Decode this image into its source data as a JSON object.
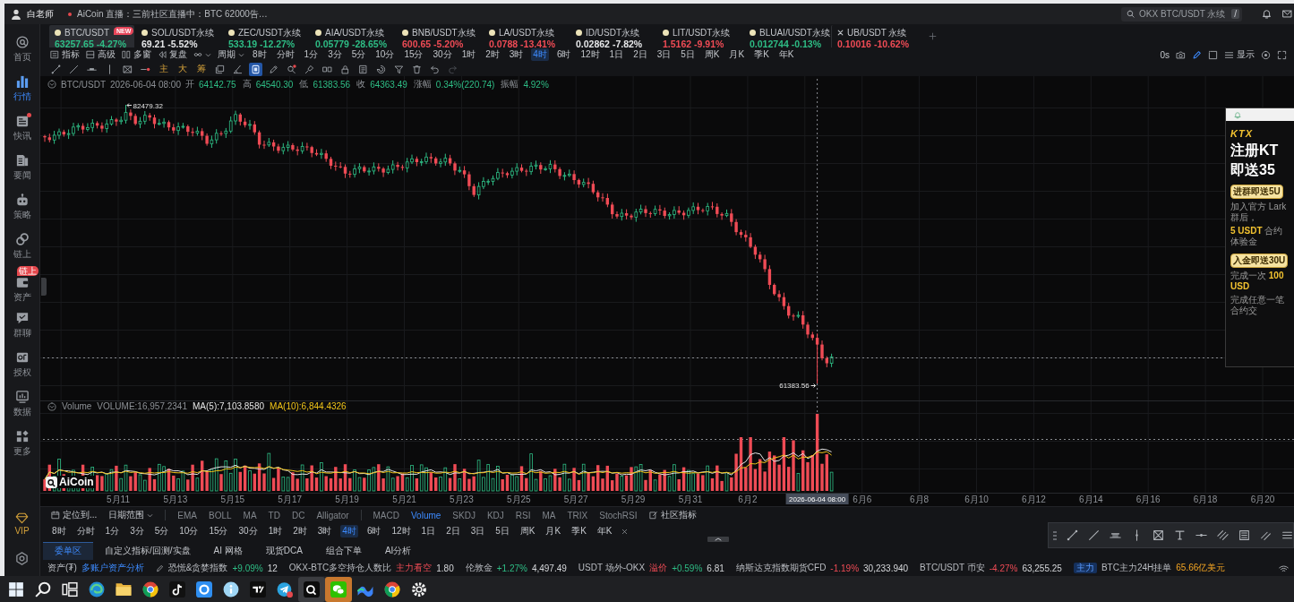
{
  "title_bar": {
    "user": "白老师",
    "live_label": "AiCoin 直播：三前社区直播中：BTC 62000告…",
    "search": {
      "value": "OKX BTC/USDT 永续",
      "shortcut": "/"
    }
  },
  "sidebar": {
    "items": [
      {
        "kind": "home",
        "label": "首页",
        "selected": false,
        "alert": false
      },
      {
        "kind": "market",
        "label": "行情",
        "selected": true,
        "alert": false
      },
      {
        "kind": "flash",
        "label": "快讯",
        "selected": false,
        "alert": true
      },
      {
        "kind": "news",
        "label": "要闻",
        "selected": false,
        "alert": false
      },
      {
        "kind": "strategy",
        "label": "策略",
        "selected": false,
        "alert": false
      },
      {
        "kind": "onchain",
        "label": "链上",
        "selected": false,
        "alert": false
      },
      {
        "kind": "assets",
        "label": "资产",
        "selected": false,
        "alert": false,
        "badge": "链上"
      },
      {
        "kind": "chat",
        "label": "群聊",
        "selected": false,
        "alert": false
      },
      {
        "kind": "auth",
        "label": "授权",
        "selected": false,
        "alert": false
      },
      {
        "kind": "data",
        "label": "数据",
        "selected": false,
        "alert": false
      },
      {
        "kind": "more",
        "label": "更多",
        "selected": false,
        "alert": false
      }
    ],
    "vip": "VIP"
  },
  "symbol_tabs": [
    {
      "symbol": "BTC/USDT",
      "price": "63257.65",
      "change": "-4.27%",
      "color": "#2ebd85",
      "selected": true,
      "closable": false,
      "badge": "NEW"
    },
    {
      "symbol": "SOL/USDT永续",
      "price": "69.21",
      "change": "-5.52%",
      "color": "#e6e7e9",
      "selected": false,
      "closable": false
    },
    {
      "symbol": "ZEC/USDT永续",
      "price": "533.19",
      "change": "-12.27%",
      "color": "#2ebd85",
      "selected": false,
      "closable": false
    },
    {
      "symbol": "AIA/USDT永续",
      "price": "0.05779",
      "change": "-28.65%",
      "color": "#2ebd85",
      "selected": false,
      "closable": false
    },
    {
      "symbol": "BNB/USDT永续",
      "price": "600.65",
      "change": "-5.20%",
      "color": "#ef4b55",
      "selected": false,
      "closable": false
    },
    {
      "symbol": "LA/USDT永续",
      "price": "0.0788",
      "change": "-13.41%",
      "color": "#ef4b55",
      "selected": false,
      "closable": false
    },
    {
      "symbol": "ID/USDT永续",
      "price": "0.02862",
      "change": "-7.82%",
      "color": "#e6e7e9",
      "selected": false,
      "closable": false
    },
    {
      "symbol": "LIT/USDT永续",
      "price": "1.5162",
      "change": "-9.91%",
      "color": "#ef4b55",
      "selected": false,
      "closable": false
    },
    {
      "symbol": "BLUAI/USDT永续",
      "price": "0.012744",
      "change": "-0.13%",
      "color": "#2ebd85",
      "selected": false,
      "closable": false
    },
    {
      "symbol": "UB/USDT 永续",
      "price": "0.10016",
      "change": "-10.62%",
      "color": "#ef4b55",
      "selected": false,
      "closable": true
    }
  ],
  "toolbar": {
    "buttons": [
      {
        "kind": "indicator",
        "label": "指标"
      },
      {
        "kind": "advanced",
        "label": "高级"
      },
      {
        "kind": "multi",
        "label": "多窗"
      },
      {
        "kind": "replay",
        "label": "复盘"
      }
    ],
    "period_menu": "周期",
    "periods": [
      {
        "label": "8时",
        "selected": false
      },
      {
        "label": "分时",
        "selected": false
      },
      {
        "label": "1分",
        "selected": false
      },
      {
        "label": "3分",
        "selected": false
      },
      {
        "label": "5分",
        "selected": false
      },
      {
        "label": "10分",
        "selected": false
      },
      {
        "label": "15分",
        "selected": false
      },
      {
        "label": "30分",
        "selected": false
      },
      {
        "label": "1时",
        "selected": false
      },
      {
        "label": "2时",
        "selected": false
      },
      {
        "label": "3时",
        "selected": false
      },
      {
        "label": "4时",
        "selected": true
      },
      {
        "label": "6时",
        "selected": false
      },
      {
        "label": "12时",
        "selected": false
      },
      {
        "label": "1日",
        "selected": false
      },
      {
        "label": "2日",
        "selected": false
      },
      {
        "label": "3日",
        "selected": false
      },
      {
        "label": "5日",
        "selected": false
      },
      {
        "label": "周K",
        "selected": false
      },
      {
        "label": "月K",
        "selected": false
      },
      {
        "label": "季K",
        "selected": false
      },
      {
        "label": "年K",
        "selected": false
      }
    ],
    "timer": "0s",
    "display": "显示"
  },
  "drawing_tools": [
    {
      "kind": "trend-line",
      "selected": false
    },
    {
      "kind": "ray",
      "selected": false
    },
    {
      "kind": "horizontal-line",
      "selected": false
    },
    {
      "kind": "vertical-line",
      "selected": false
    },
    {
      "kind": "box",
      "selected": false
    },
    {
      "kind": "marker",
      "selected": false
    },
    {
      "kind": "text",
      "label": "主",
      "selected": false
    },
    {
      "kind": "text",
      "label": "大",
      "selected": false
    },
    {
      "kind": "text",
      "label": "筹",
      "selected": false
    },
    {
      "kind": "copy",
      "selected": false
    },
    {
      "kind": "ruler",
      "selected": false
    },
    {
      "kind": "square",
      "selected": true
    },
    {
      "kind": "pencil",
      "selected": false
    },
    {
      "kind": "zoom",
      "selected": false
    },
    {
      "kind": "brush",
      "selected": false
    },
    {
      "kind": "link",
      "selected": false
    },
    {
      "kind": "lock",
      "selected": false
    },
    {
      "kind": "note",
      "selected": false
    },
    {
      "kind": "eye",
      "selected": false
    },
    {
      "kind": "filter",
      "selected": false
    },
    {
      "kind": "trash",
      "selected": false
    },
    {
      "kind": "undo",
      "selected": false
    },
    {
      "kind": "redo",
      "selected": false
    }
  ],
  "quote_info": {
    "symbol": "BTC/USDT",
    "time": "2026-06-04 08:00",
    "fields": [
      {
        "label": "开",
        "value": "64142.75"
      },
      {
        "label": "高",
        "value": "64540.30"
      },
      {
        "label": "低",
        "value": "61383.56"
      },
      {
        "label": "收",
        "value": "64363.49"
      },
      {
        "label": "涨幅",
        "value": "0.34%(220.74)"
      },
      {
        "label": "振幅",
        "value": "4.92%"
      }
    ]
  },
  "price_chart": {
    "high_label": "82479.32",
    "low_label": "61383.56",
    "x_axis": [
      {
        "kind": "tick",
        "label": "5月11"
      },
      {
        "kind": "tick",
        "label": "5月13"
      },
      {
        "kind": "tick",
        "label": "5月15"
      },
      {
        "kind": "tick",
        "label": "5月17"
      },
      {
        "kind": "tick",
        "label": "5月19"
      },
      {
        "kind": "tick",
        "label": "5月21"
      },
      {
        "kind": "tick",
        "label": "5月23"
      },
      {
        "kind": "tick",
        "label": "5月25"
      },
      {
        "kind": "tick",
        "label": "5月27"
      },
      {
        "kind": "tick",
        "label": "5月29"
      },
      {
        "kind": "tick",
        "label": "5月31"
      },
      {
        "kind": "tick",
        "label": "6月2"
      },
      {
        "kind": "crosshair",
        "label": "2026-06-04 08:00"
      },
      {
        "kind": "tick",
        "label": "6月6"
      },
      {
        "kind": "tick",
        "label": "6月8"
      },
      {
        "kind": "tick",
        "label": "6月10"
      },
      {
        "kind": "tick",
        "label": "6月12"
      },
      {
        "kind": "tick",
        "label": "6月14"
      },
      {
        "kind": "tick",
        "label": "6月16"
      },
      {
        "kind": "tick",
        "label": "6月18"
      },
      {
        "kind": "tick",
        "label": "6月20"
      }
    ],
    "logo": "AiCoin",
    "volume_legend": {
      "name": "Volume",
      "value": "VOLUME:16,957.2341",
      "ma5": "MA(5):7,103.8580",
      "ma10": "MA(10):6,844.4326"
    }
  },
  "ad": {
    "brand": "KTX",
    "headline": [
      "注册KT",
      "即送35"
    ],
    "offers": [
      {
        "button": "进群即送5U",
        "lines": [
          "加入官方 Lark 群后，",
          "**5 USDT** 合约体验金"
        ]
      },
      {
        "button": "入金即送30U",
        "lines": [
          "完成一次 **100 USD**",
          "完成任意一笔合约交"
        ]
      }
    ]
  },
  "indicator_bar": {
    "locate": "定位到...",
    "date_range": "日期范围",
    "main_indicators": [
      {
        "label": "EMA",
        "selected": false
      },
      {
        "label": "BOLL",
        "selected": false
      },
      {
        "label": "MA",
        "selected": false
      },
      {
        "label": "TD",
        "selected": false
      },
      {
        "label": "DC",
        "selected": false
      },
      {
        "label": "Alligator",
        "selected": false
      }
    ],
    "sub_indicators": [
      {
        "label": "MACD",
        "selected": false
      },
      {
        "label": "Volume",
        "selected": true
      },
      {
        "label": "SKDJ",
        "selected": false
      },
      {
        "label": "KDJ",
        "selected": false
      },
      {
        "label": "RSI",
        "selected": false
      },
      {
        "label": "MA",
        "selected": false
      },
      {
        "label": "TRIX",
        "selected": false
      },
      {
        "label": "StochRSI",
        "selected": false
      }
    ],
    "community": "社区指标"
  },
  "bottom_periods": [
    {
      "label": "8时",
      "selected": false
    },
    {
      "label": "分时",
      "selected": false
    },
    {
      "label": "1分",
      "selected": false
    },
    {
      "label": "3分",
      "selected": false
    },
    {
      "label": "5分",
      "selected": false
    },
    {
      "label": "10分",
      "selected": false
    },
    {
      "label": "15分",
      "selected": false
    },
    {
      "label": "30分",
      "selected": false
    },
    {
      "label": "1时",
      "selected": false
    },
    {
      "label": "2时",
      "selected": false
    },
    {
      "label": "3时",
      "selected": false
    },
    {
      "label": "4时",
      "selected": true
    },
    {
      "label": "6时",
      "selected": false
    },
    {
      "label": "12时",
      "selected": false
    },
    {
      "label": "1日",
      "selected": false
    },
    {
      "label": "2日",
      "selected": false
    },
    {
      "label": "3日",
      "selected": false
    },
    {
      "label": "5日",
      "selected": false
    },
    {
      "label": "周K",
      "selected": false
    },
    {
      "label": "月K",
      "selected": false
    },
    {
      "label": "季K",
      "selected": false
    },
    {
      "label": "年K",
      "selected": false
    }
  ],
  "order_tabs": [
    {
      "label": "委单区",
      "selected": true
    },
    {
      "label": "自定义指标/回测/实盘",
      "selected": false
    },
    {
      "label": "AI 网格",
      "selected": false
    },
    {
      "label": "现货DCA",
      "selected": false
    },
    {
      "label": "组合下单",
      "selected": false
    },
    {
      "label": "AI分析",
      "selected": false
    }
  ],
  "ticker": [
    {
      "parts": [
        {
          "kind": "label",
          "text": "资产(₮)"
        },
        {
          "kind": "link",
          "text": "多账户资产分析"
        }
      ]
    },
    {
      "parts": [
        {
          "kind": "edit"
        },
        {
          "kind": "label",
          "text": "恐慌&贪婪指数"
        },
        {
          "kind": "up",
          "text": "+9.09%"
        },
        {
          "kind": "value",
          "text": "12"
        }
      ]
    },
    {
      "parts": [
        {
          "kind": "label",
          "text": "OKX-BTC多空持仓人数比"
        },
        {
          "kind": "warn",
          "text": "主力看空"
        },
        {
          "kind": "value",
          "text": "1.80"
        }
      ]
    },
    {
      "parts": [
        {
          "kind": "label",
          "text": "伦敦金"
        },
        {
          "kind": "up",
          "text": "+1.27%"
        },
        {
          "kind": "value",
          "text": "4,497.49"
        }
      ]
    },
    {
      "parts": [
        {
          "kind": "label",
          "text": "USDT 场外-OKX"
        },
        {
          "kind": "warn",
          "text": "溢价"
        },
        {
          "kind": "up",
          "text": "+0.59%"
        },
        {
          "kind": "value",
          "text": "6.81"
        }
      ]
    },
    {
      "parts": [
        {
          "kind": "label",
          "text": "纳斯达克指数期货CFD"
        },
        {
          "kind": "down",
          "text": "-1.19%"
        },
        {
          "kind": "value",
          "text": "30,233.940"
        }
      ]
    },
    {
      "parts": [
        {
          "kind": "label",
          "text": "BTC/USDT 币安"
        },
        {
          "kind": "down",
          "text": "-4.27%"
        },
        {
          "kind": "value",
          "text": "63,255.25"
        }
      ]
    },
    {
      "parts": [
        {
          "kind": "tag",
          "text": "主力"
        },
        {
          "kind": "label",
          "text": "BTC主力24H挂单"
        },
        {
          "kind": "highlight",
          "text": "65.66亿美元"
        }
      ]
    }
  ],
  "taskbar": [
    {
      "kind": "start",
      "selected": false,
      "attention": false
    },
    {
      "kind": "search",
      "selected": false,
      "attention": false
    },
    {
      "kind": "taskview",
      "selected": false,
      "attention": false
    },
    {
      "kind": "swirl",
      "selected": false,
      "attention": false
    },
    {
      "kind": "folder",
      "selected": false,
      "attention": false
    },
    {
      "kind": "browser",
      "selected": false,
      "attention": false
    },
    {
      "kind": "note",
      "selected": false,
      "attention": false
    },
    {
      "kind": "ring",
      "selected": false,
      "attention": false
    },
    {
      "kind": "info",
      "selected": false,
      "attention": false
    },
    {
      "kind": "chart",
      "selected": false,
      "attention": false
    },
    {
      "kind": "plane",
      "selected": false,
      "attention": false
    },
    {
      "kind": "coin",
      "selected": true,
      "attention": false
    },
    {
      "kind": "chat",
      "selected": false,
      "attention": true
    },
    {
      "kind": "wave",
      "selected": false,
      "attention": false
    },
    {
      "kind": "browser",
      "selected": false,
      "attention": false
    },
    {
      "kind": "gear",
      "selected": false,
      "attention": false
    }
  ]
}
